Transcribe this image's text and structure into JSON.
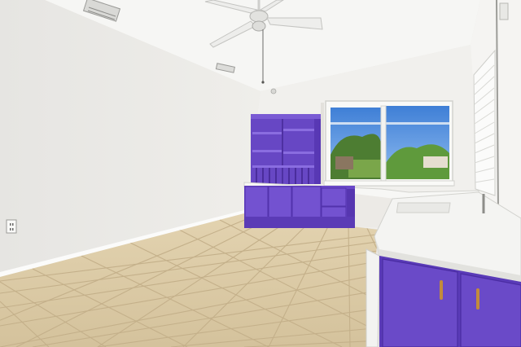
{
  "colors": {
    "wall_left": "#ecebe8",
    "wall_back": "#f2f1ee",
    "wall_right": "#f4f3f1",
    "ceiling": "#f7f7f5",
    "floor_tile": "#d9c8a4",
    "floor_grout": "#c2ae88",
    "cabinet_purple": "#6a48c8",
    "cabinet_purple_dark": "#4f31a6",
    "cabinet_purple_light": "#7b5ad6",
    "countertop": "#f6f6f4",
    "sky": "#4f8fe0",
    "foliage": "#5c8f3a",
    "knob": "#c08a3a"
  },
  "icons": [
    "ceiling-fan-icon",
    "air-vent-icon",
    "wall-outlet-icon",
    "cabinet-handle-icon"
  ]
}
